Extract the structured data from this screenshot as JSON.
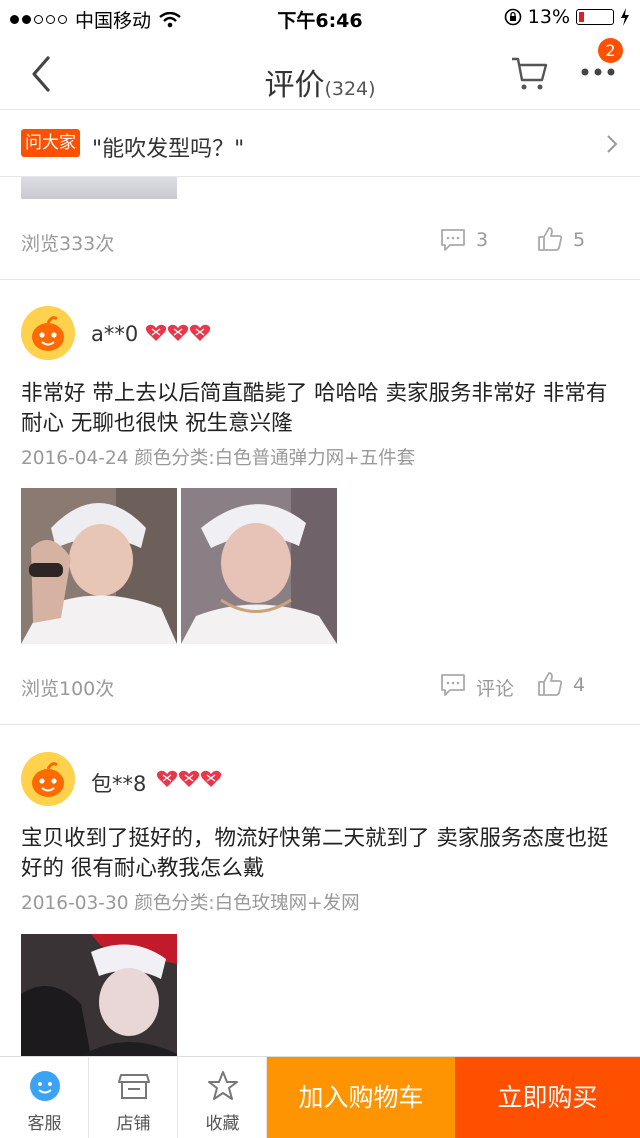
{
  "status_bar": {
    "carrier": "中国移动",
    "time": "下午6:46",
    "battery": "13%"
  },
  "header": {
    "title": "评价",
    "count": "(324)",
    "badge": "2",
    "icons": {
      "back": "chevron-left-icon",
      "cart": "cart-icon",
      "more": "more-icon"
    }
  },
  "ask_bar": {
    "tag": "问大家",
    "question": "\"能吹发型吗？\""
  },
  "prev_card": {
    "views": "浏览333次",
    "comments": "3",
    "likes": "5"
  },
  "reviews": [
    {
      "name": "a**0",
      "text": "非常好 带上去以后简直酷毙了 哈哈哈 卖家服务非常好 非常有耐心 无聊也很快 祝生意兴隆",
      "date": "2016-04-24",
      "meta": "颜色分类:白色普通弹力网+五件套",
      "views": "浏览100次",
      "comments": "评论",
      "likes": "4"
    },
    {
      "name": "包**8",
      "text": "宝贝收到了挺好的，物流好快第二天就到了 卖家服务态度也挺好的 很有耐心教我怎么戴",
      "date": "2016-03-30",
      "meta": "颜色分类:白色玫瑰网+发网"
    }
  ],
  "bottom_bar": {
    "service": "客服",
    "shop": "店铺",
    "favorite": "收藏",
    "add_to_cart": "加入购物车",
    "buy_now": "立即购买"
  },
  "colors": {
    "accent": "#ff5000",
    "cart_button": "#ff9402",
    "heart": "#e8374b"
  }
}
